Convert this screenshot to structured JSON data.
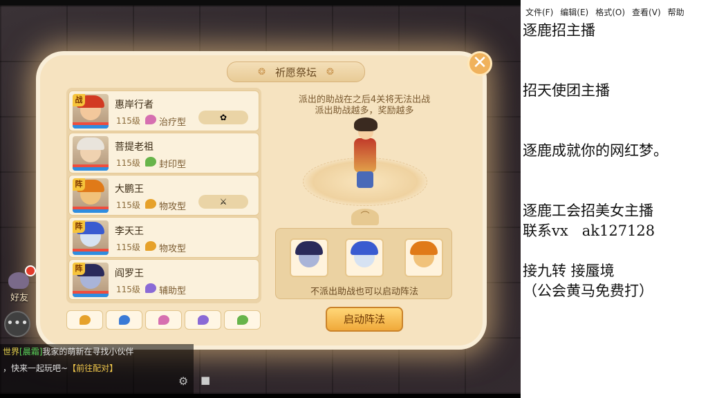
{
  "game": {
    "panel_title": "祈愿祭坛",
    "close_label": "✕",
    "heroes": [
      {
        "tag": "战",
        "name": "惠岸行者",
        "level": "115级",
        "role": "治疗型",
        "role_color": "#d66fb0",
        "equip": "✿",
        "face": "#f3c89c",
        "hair": "#d23a22"
      },
      {
        "tag": "",
        "name": "菩提老祖",
        "level": "115级",
        "role": "封印型",
        "role_color": "#67b44a",
        "equip": "",
        "face": "#f0d2b0",
        "hair": "#e9e4dc"
      },
      {
        "tag": "阵",
        "name": "大鹏王",
        "level": "115级",
        "role": "物攻型",
        "role_color": "#e6a12a",
        "equip": "⚔",
        "face": "#f1c27a",
        "hair": "#e07a18"
      },
      {
        "tag": "阵",
        "name": "李天王",
        "level": "115级",
        "role": "物攻型",
        "role_color": "#e6a12a",
        "equip": "",
        "face": "#d6e2f2",
        "hair": "#3a5bd0"
      },
      {
        "tag": "阵",
        "name": "阎罗王",
        "level": "115级",
        "role": "辅助型",
        "role_color": "#8a6ad6",
        "equip": "",
        "face": "#a9b4d8",
        "hair": "#2a2a5a"
      }
    ],
    "filters": [
      {
        "icon": "filter-physical-icon",
        "color": "#e6a12a"
      },
      {
        "icon": "filter-magic-icon",
        "color": "#3a7ad6"
      },
      {
        "icon": "filter-heal-icon",
        "color": "#d66fb0"
      },
      {
        "icon": "filter-support-icon",
        "color": "#8a6ad6"
      },
      {
        "icon": "filter-seal-icon",
        "color": "#67b44a"
      }
    ],
    "hint_line1": "派出的助战在之后4关将无法出战",
    "hint_line2": "派出助战越多，奖励越多",
    "assist_note": "不派出助战也可以启动阵法",
    "assist_heroes": [
      {
        "face": "#a9b4d8",
        "hair": "#2a2a5a"
      },
      {
        "face": "#d6e2f2",
        "hair": "#3a5bd0"
      },
      {
        "face": "#f1c27a",
        "hair": "#e07a18"
      }
    ],
    "start_button": "启动阵法",
    "friend_label": "好友",
    "chat": [
      {
        "channel": "世界",
        "user": "[晨霜]",
        "text": "我家的萌新在寻找小伙伴",
        "link": ""
      },
      {
        "channel": "",
        "user": "",
        "text": "，快来一起玩吧~",
        "link": "【前往配对】"
      },
      {
        "channel": "",
        "user": "",
        "text": "",
        "link": ""
      }
    ]
  },
  "notepad": {
    "menu": [
      "文件(F)",
      "编辑(E)",
      "格式(O)",
      "查看(V)",
      "帮助"
    ],
    "text": "逐鹿招主播\n\n\n招天使团主播\n\n\n逐鹿成就你的网红梦。\n\n\n逐鹿工会招美女主播\n联系vx   ak127128\n\n接九转 接蜃境\n（公会黄马免费打）"
  }
}
